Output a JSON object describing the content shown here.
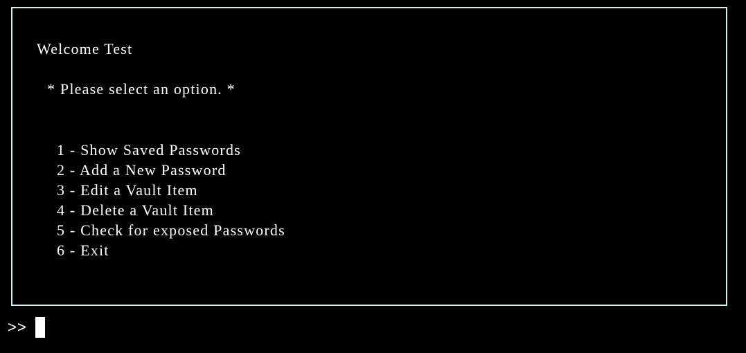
{
  "header": {
    "welcome": "Welcome Test",
    "instruction": "* Please select an option. *"
  },
  "menu": {
    "items": [
      {
        "label": "1 - Show Saved Passwords"
      },
      {
        "label": "2 - Add a New Password"
      },
      {
        "label": "3 - Edit a Vault Item"
      },
      {
        "label": "4 - Delete a Vault Item"
      },
      {
        "label": "5 - Check for exposed Passwords"
      },
      {
        "label": "6 - Exit"
      }
    ]
  },
  "console": {
    "prompt": ">>"
  },
  "colors": {
    "background": "#000000",
    "text": "#ffffff",
    "border": "#cfeff0"
  }
}
